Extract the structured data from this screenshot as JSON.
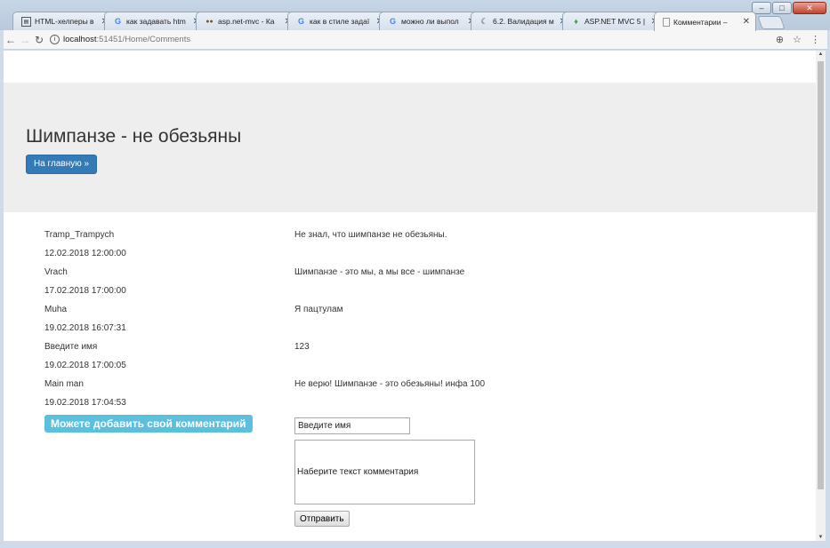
{
  "browser": {
    "tabs": [
      {
        "icon": "page-icon",
        "title": "HTML-хелперы в"
      },
      {
        "icon": "google-icon",
        "title": "как задавать htm"
      },
      {
        "icon": "stackoverflow-icon",
        "title": "asp.net-mvc - Ка"
      },
      {
        "icon": "google-icon",
        "title": "как в стиле задаї"
      },
      {
        "icon": "google-icon",
        "title": "можно ли выпол"
      },
      {
        "icon": "metanit-icon",
        "title": "6.2. Валидация м"
      },
      {
        "icon": "leaf-icon",
        "title": "ASP.NET MVC 5 |"
      },
      {
        "icon": "page-icon",
        "title": "Комментарии –"
      }
    ],
    "url_host": "localhost",
    "url_rest": ":51451/Home/Comments"
  },
  "page": {
    "title": "Шимпанзе - не обезьяны",
    "home_button": "На главную »",
    "comments": [
      {
        "author": "Tramp_Trampych",
        "date": "12.02.2018 12:00:00",
        "text": "Не знал, что шимпанзе не обезьяны."
      },
      {
        "author": "Vrach",
        "date": "17.02.2018 17:00:00",
        "text": "Шимпанзе - это мы, а мы все - шимпанзе"
      },
      {
        "author": "Muha",
        "date": "19.02.2018 16:07:31",
        "text": "Я пацтулам"
      },
      {
        "author": "Введите имя",
        "date": "19.02.2018 17:00:05",
        "text": "123"
      },
      {
        "author": "Main man",
        "date": "19.02.2018 17:04:53",
        "text": "Не верю! Шимпанзе - это обезьяны! инфа 100"
      }
    ],
    "add_label": "Можете добавить свой комментарий",
    "form": {
      "name_placeholder": "Введите имя",
      "text_placeholder": "Наберите текст комментария",
      "submit": "Отправить"
    }
  },
  "colors": {
    "primary": "#337ab7",
    "info": "#5bc0de",
    "jumbotron": "#eeeeee"
  }
}
